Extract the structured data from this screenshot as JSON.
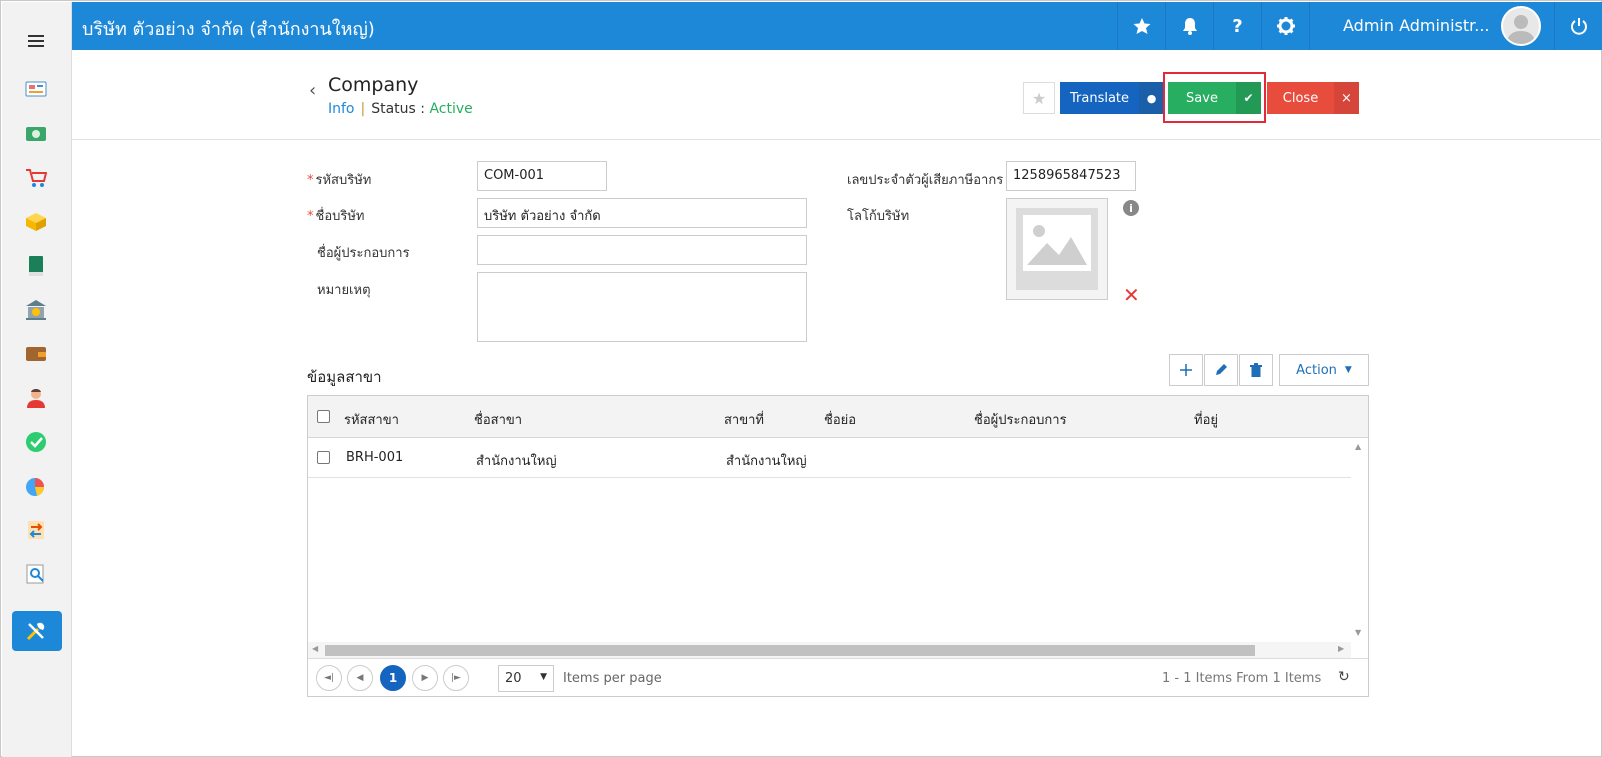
{
  "topbar": {
    "title": "บริษัท ตัวอย่าง จำกัด (สำนักงานใหญ่)",
    "user": "Admin Administr...",
    "icons": [
      "star-icon",
      "bell-icon",
      "help-icon",
      "gear-icon",
      "power-icon"
    ]
  },
  "sidebar": {
    "items": [
      "dashboard-icon",
      "money-icon",
      "cart-icon",
      "box-icon",
      "book-icon",
      "bank-icon",
      "wallet-icon",
      "people-icon",
      "check-icon",
      "pie-chart-icon",
      "transfer-icon",
      "search-report-icon",
      "tools-icon"
    ],
    "active": "tools-icon"
  },
  "header": {
    "title": "Company",
    "info_link": "Info",
    "separator": "|",
    "status_label": "Status",
    "status_colon": ":",
    "status_value": "Active",
    "translate_label": "Translate",
    "save_label": "Save",
    "close_label": "Close"
  },
  "form": {
    "company_code_label": "รหัสบริษัท",
    "company_code_value": "COM-001",
    "company_name_label": "ชื่อบริษัท",
    "company_name_value": "บริษัท ตัวอย่าง จำกัด",
    "operator_label": "ชื่อผู้ประกอบการ",
    "operator_value": "",
    "remark_label": "หมายเหตุ",
    "remark_value": "",
    "tax_id_label": "เลขประจำตัวผู้เสียภาษีอากร",
    "tax_id_value": "1258965847523",
    "logo_label": "โลโก้บริษัท"
  },
  "branch": {
    "section_title": "ข้อมูลสาขา",
    "action_label": "Action",
    "columns": [
      "รหัสสาขา",
      "ชื่อสาขา",
      "สาขาที่",
      "ชื่อย่อ",
      "ชื่อผู้ประกอบการ",
      "ที่อยู่"
    ],
    "rows": [
      {
        "code": "BRH-001",
        "name": "สำนักงานใหญ่",
        "branch_no": "สำนักงานใหญ่",
        "short_name": "",
        "operator": "",
        "address": ""
      }
    ],
    "pager": {
      "current_page": "1",
      "per_page": "20",
      "per_page_label": "Items per page",
      "items_info": "1 - 1 Items From 1 Items"
    }
  },
  "colors": {
    "topbar": "#1e88d8",
    "translate": "#1565c0",
    "save": "#27ae60",
    "close": "#e74c3c",
    "highlight": "#e02b3c"
  }
}
